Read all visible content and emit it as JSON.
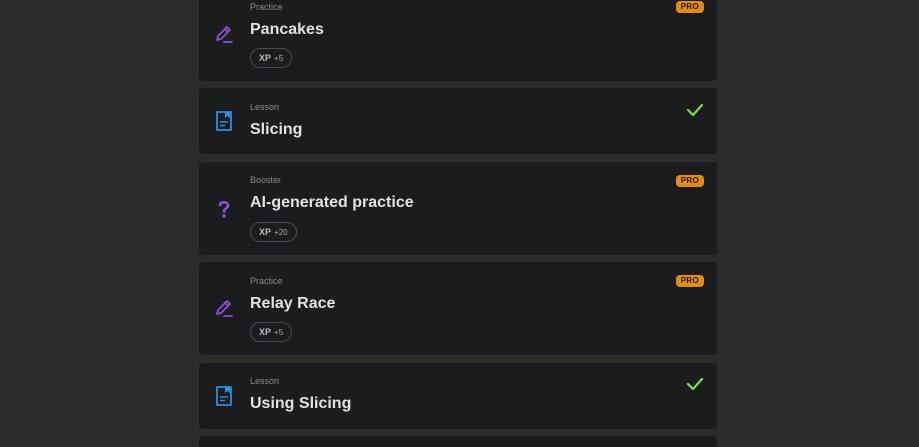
{
  "colors": {
    "page_background": "#2b2b2b",
    "card_background": "#1b1c1e",
    "practice_icon": "#8a52d8",
    "lesson_icon": "#2b8fde",
    "booster_icon": "#8a52d8",
    "check": "#7fdc4f",
    "pro_badge": "#e08c17"
  },
  "cards": [
    {
      "kind": "Practice",
      "title": "Pancakes",
      "icon": "pencil-icon",
      "pro": "PRO",
      "xp_label": "XP",
      "xp_value": "+5"
    },
    {
      "kind": "Lesson",
      "title": "Slicing",
      "icon": "document-icon",
      "status": "completed"
    },
    {
      "kind": "Booster",
      "title": "AI-generated practice",
      "icon": "question-mark-icon",
      "pro": "PRO",
      "xp_label": "XP",
      "xp_value": "+20"
    },
    {
      "kind": "Practice",
      "title": "Relay Race",
      "icon": "pencil-icon",
      "pro": "PRO",
      "xp_label": "XP",
      "xp_value": "+5"
    },
    {
      "kind": "Lesson",
      "title": "Using Slicing",
      "icon": "document-icon",
      "status": "completed"
    }
  ]
}
